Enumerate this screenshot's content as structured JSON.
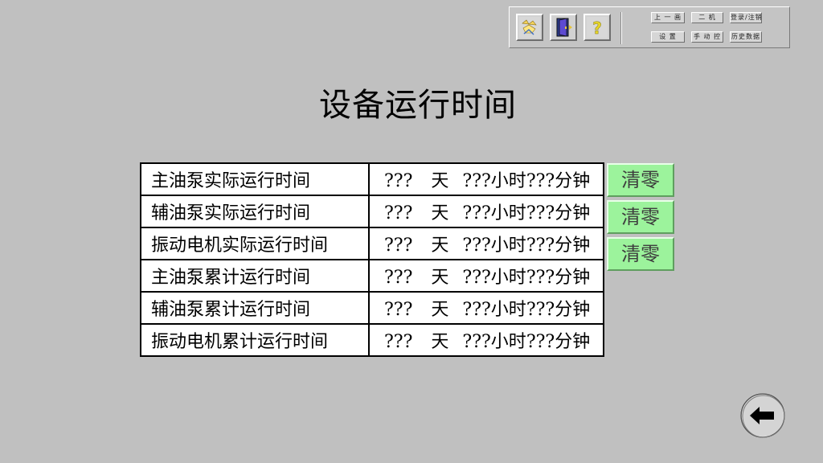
{
  "toolbar": {
    "icons": [
      "alarm-bell-icon",
      "exit-door-icon",
      "help-icon"
    ],
    "buttons": [
      {
        "label": "上 一 画"
      },
      {
        "label": "二 机"
      },
      {
        "label": "登录/注销"
      },
      {
        "label": "设 置"
      },
      {
        "label": "手 动 控"
      },
      {
        "label": "历史数据"
      }
    ]
  },
  "page": {
    "title": "设备运行时间"
  },
  "runtime_table": {
    "rows": [
      {
        "label": "主油泵实际运行时间",
        "days": "???",
        "day_unit": "天",
        "hours": "???",
        "hour_unit": "小时",
        "minutes": "???",
        "minute_unit": "分钟"
      },
      {
        "label": "辅油泵实际运行时间",
        "days": "???",
        "day_unit": "天",
        "hours": "???",
        "hour_unit": "小时",
        "minutes": "???",
        "minute_unit": "分钟"
      },
      {
        "label": "振动电机实际运行时间",
        "days": "???",
        "day_unit": "天",
        "hours": "???",
        "hour_unit": "小时",
        "minutes": "???",
        "minute_unit": "分钟"
      },
      {
        "label": "主油泵累计运行时间",
        "days": "???",
        "day_unit": "天",
        "hours": "???",
        "hour_unit": "小时",
        "minutes": "???",
        "minute_unit": "分钟"
      },
      {
        "label": "辅油泵累计运行时间",
        "days": "???",
        "day_unit": "天",
        "hours": "???",
        "hour_unit": "小时",
        "minutes": "???",
        "minute_unit": "分钟"
      },
      {
        "label": "振动电机累计运行时间",
        "days": "???",
        "day_unit": "天",
        "hours": "???",
        "hour_unit": "小时",
        "minutes": "???",
        "minute_unit": "分钟"
      }
    ]
  },
  "reset_buttons": [
    {
      "label": "清零"
    },
    {
      "label": "清零"
    },
    {
      "label": "清零"
    }
  ],
  "navigation": {
    "back_icon": "left-arrow-icon"
  },
  "colors": {
    "background": "#c0c0c0",
    "reset_button": "#9cf39c",
    "table_background": "#ffffff"
  }
}
